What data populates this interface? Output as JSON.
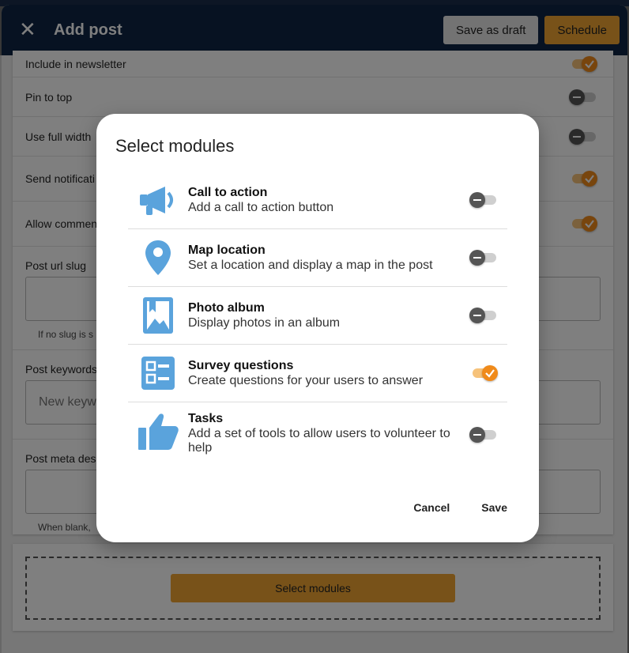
{
  "header": {
    "title": "Add post",
    "save_draft_label": "Save as draft",
    "schedule_label": "Schedule"
  },
  "settings": {
    "rows": [
      {
        "label": "Include in newsletter",
        "on": true
      },
      {
        "label": "Pin to top",
        "on": false
      },
      {
        "label": "Use full width",
        "on": false
      },
      {
        "label": "Send notificati",
        "on": true
      },
      {
        "label": "Allow commen",
        "on": true
      }
    ],
    "slug_label": "Post url slug",
    "slug_hint": "If no slug is s",
    "keywords_label": "Post keywords",
    "keywords_placeholder": "New keyw",
    "meta_label": "Post meta des",
    "meta_hint": "When blank,"
  },
  "modules_card": {
    "select_label": "Select modules"
  },
  "dialog": {
    "title": "Select modules",
    "modules": [
      {
        "title": "Call to action",
        "description": "Add a call to action button",
        "icon": "megaphone-icon",
        "on": false
      },
      {
        "title": "Map location",
        "description": "Set a location and display a map in the post",
        "icon": "map-pin-icon",
        "on": false
      },
      {
        "title": "Photo album",
        "description": "Display photos in an album",
        "icon": "photo-album-icon",
        "on": false
      },
      {
        "title": "Survey questions",
        "description": "Create questions for your users to answer",
        "icon": "survey-icon",
        "on": true
      },
      {
        "title": "Tasks",
        "description": "Add a set of tools to allow users to volunteer to help",
        "icon": "thumbs-up-icon",
        "on": false
      }
    ],
    "cancel_label": "Cancel",
    "save_label": "Save"
  },
  "colors": {
    "header_bg": "#0e2545",
    "accent": "#f0a432",
    "toggle_on": "#f08a1a",
    "icon_blue": "#5aa3dc"
  }
}
